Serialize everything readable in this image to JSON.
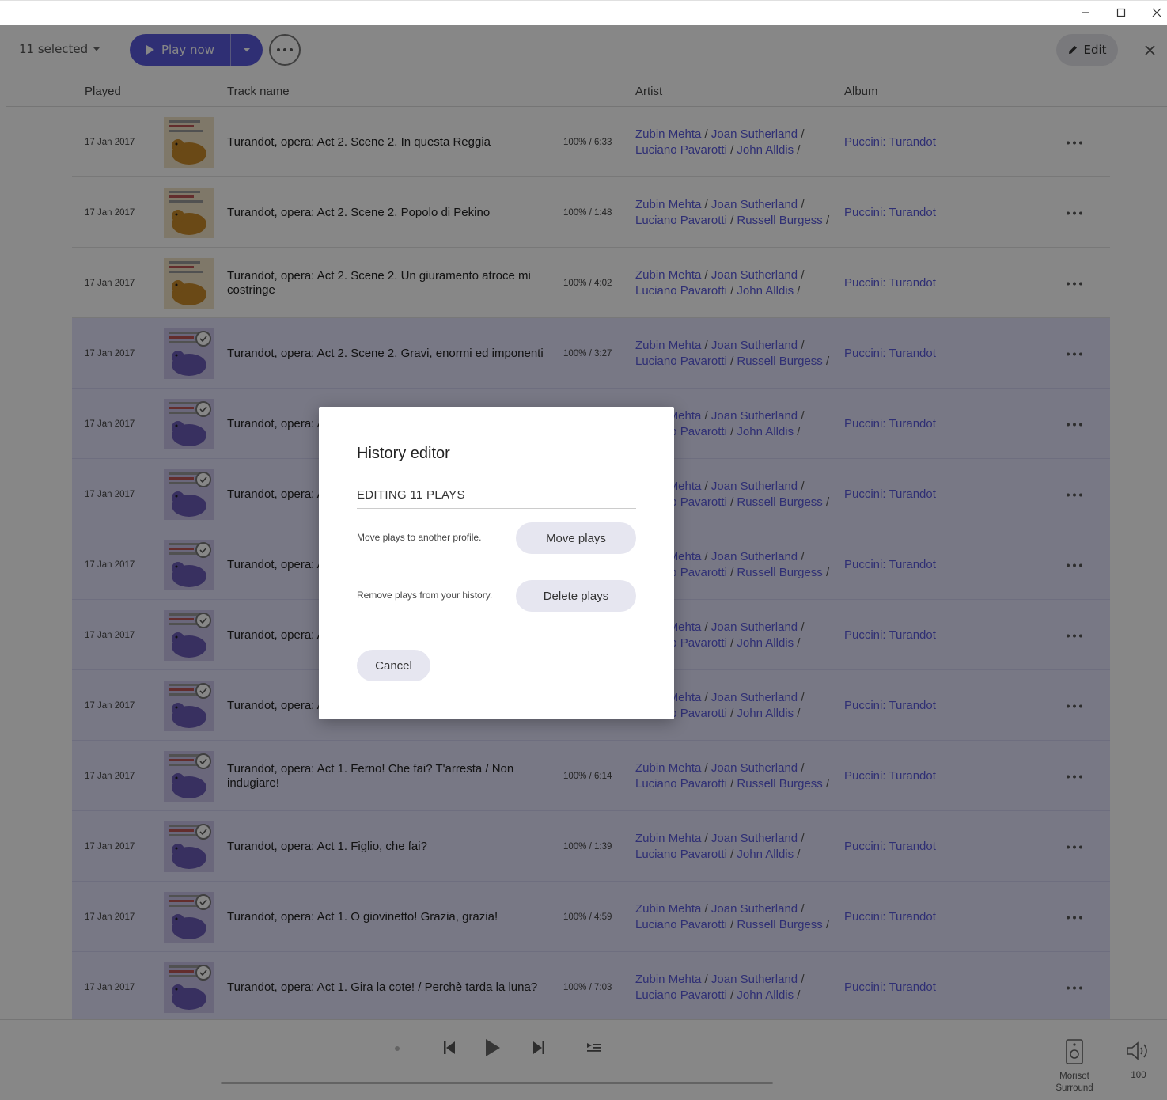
{
  "toolbar": {
    "selected_label": "11 selected",
    "play_now_label": "Play now",
    "edit_label": "Edit"
  },
  "columns": {
    "played": "Played",
    "track": "Track name",
    "artist": "Artist",
    "album": "Album"
  },
  "rows": [
    {
      "date": "17 Jan 2017",
      "track": "Turandot, opera: Act 2. Scene 2. In questa Reggia",
      "dur": "100% / 6:33",
      "a1": "Zubin Mehta",
      "a2": "Joan Sutherland",
      "a3": "Luciano Pavarotti",
      "a4": "John Alldis",
      "album": "Puccini: Turandot",
      "selected": false
    },
    {
      "date": "17 Jan 2017",
      "track": "Turandot, opera: Act 2. Scene 2. Popolo di Pekino",
      "dur": "100% / 1:48",
      "a1": "Zubin Mehta",
      "a2": "Joan Sutherland",
      "a3": "Luciano Pavarotti",
      "a4": "Russell Burgess",
      "album": "Puccini: Turandot",
      "selected": false
    },
    {
      "date": "17 Jan 2017",
      "track": "Turandot, opera: Act 2. Scene 2. Un giuramento atroce mi costringe",
      "dur": "100% / 4:02",
      "a1": "Zubin Mehta",
      "a2": "Joan Sutherland",
      "a3": "Luciano Pavarotti",
      "a4": "John Alldis",
      "album": "Puccini: Turandot",
      "selected": false
    },
    {
      "date": "17 Jan 2017",
      "track": "Turandot, opera: Act 2. Scene 2. Gravi, enormi ed imponenti",
      "dur": "100% / 3:27",
      "a1": "Zubin Mehta",
      "a2": "Joan Sutherland",
      "a3": "Luciano Pavarotti",
      "a4": "Russell Burgess",
      "album": "Puccini: Turandot",
      "selected": true
    },
    {
      "date": "17 Jan 2017",
      "track": "Turandot, opera: A",
      "dur": "",
      "a1": "Zubin Mehta",
      "a2": "Joan Sutherland",
      "a3": "Luciano Pavarotti",
      "a4": "John Alldis",
      "album": "Puccini: Turandot",
      "selected": true
    },
    {
      "date": "17 Jan 2017",
      "track": "Turandot, opera: A tigre! O tigre!",
      "dur": "",
      "a1": "Zubin Mehta",
      "a2": "Joan Sutherland",
      "a3": "Luciano Pavarotti",
      "a4": "Russell Burgess",
      "album": "Puccini: Turandot",
      "selected": true
    },
    {
      "date": "17 Jan 2017",
      "track": "Turandot, opera: A",
      "dur": "",
      "a1": "Zubin Mehta",
      "a2": "Joan Sutherland",
      "a3": "Luciano Pavarotti",
      "a4": "Russell Burgess",
      "album": "Puccini: Turandot",
      "selected": true
    },
    {
      "date": "17 Jan 2017",
      "track": "Turandot, opera: A",
      "dur": "",
      "a1": "Zubin Mehta",
      "a2": "Joan Sutherland",
      "a3": "Luciano Pavarotti",
      "a4": "John Alldis",
      "album": "Puccini: Turandot",
      "selected": true
    },
    {
      "date": "17 Jan 2017",
      "track": "Turandot, opera: A volta!",
      "dur": "",
      "a1": "Zubin Mehta",
      "a2": "Joan Sutherland",
      "a3": "Luciano Pavarotti",
      "a4": "John Alldis",
      "album": "Puccini: Turandot",
      "selected": true
    },
    {
      "date": "17 Jan 2017",
      "track": "Turandot, opera: Act 1. Ferno! Che fai? T'arresta / Non indugiare!",
      "dur": "100% / 6:14",
      "a1": "Zubin Mehta",
      "a2": "Joan Sutherland",
      "a3": "Luciano Pavarotti",
      "a4": "Russell Burgess",
      "album": "Puccini: Turandot",
      "selected": true
    },
    {
      "date": "17 Jan 2017",
      "track": "Turandot, opera: Act 1. Figlio, che fai?",
      "dur": "100% / 1:39",
      "a1": "Zubin Mehta",
      "a2": "Joan Sutherland",
      "a3": "Luciano Pavarotti",
      "a4": "John Alldis",
      "album": "Puccini: Turandot",
      "selected": true
    },
    {
      "date": "17 Jan 2017",
      "track": "Turandot, opera: Act 1. O giovinetto! Grazia, grazia!",
      "dur": "100% / 4:59",
      "a1": "Zubin Mehta",
      "a2": "Joan Sutherland",
      "a3": "Luciano Pavarotti",
      "a4": "Russell Burgess",
      "album": "Puccini: Turandot",
      "selected": true
    },
    {
      "date": "17 Jan 2017",
      "track": "Turandot, opera: Act 1. Gira la cote! / Perchè tarda la luna?",
      "dur": "100% / 7:03",
      "a1": "Zubin Mehta",
      "a2": "Joan Sutherland",
      "a3": "Luciano Pavarotti",
      "a4": "John Alldis",
      "album": "Puccini: Turandot",
      "selected": true
    }
  ],
  "player": {
    "zone_name": "Morisot Surround",
    "volume": "100"
  },
  "dialog": {
    "title": "History editor",
    "subtitle": "EDITING 11 PLAYS",
    "move_desc": "Move plays to another profile.",
    "move_label": "Move plays",
    "delete_desc": "Remove plays from your history.",
    "delete_label": "Delete plays",
    "cancel_label": "Cancel"
  },
  "colors": {
    "accent": "#5a5adb",
    "selected_row": "#e3e3fb"
  }
}
